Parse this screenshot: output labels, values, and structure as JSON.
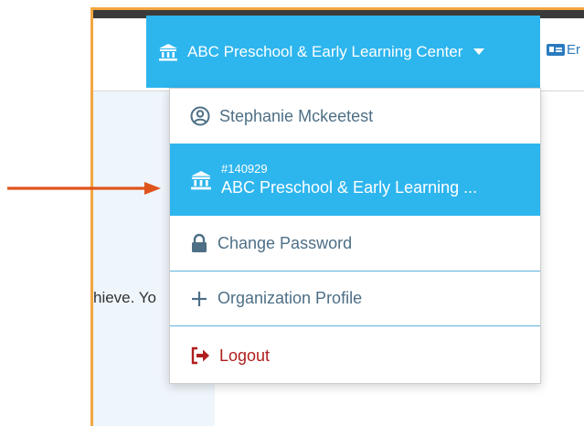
{
  "header": {
    "org_button_label": "ABC Preschool & Early Learning Center",
    "next_button_label": "Er"
  },
  "background": {
    "partial_text": "hieve. Yo"
  },
  "menu": {
    "user_name": "Stephanie Mckeetest",
    "org_id": "#140929",
    "org_name": "ABC Preschool & Early Learning ...",
    "change_password": "Change Password",
    "organization_profile": "Organization Profile",
    "logout": "Logout"
  },
  "icons": {
    "org_button": "bank-icon",
    "user": "user-circle-icon",
    "org": "bank-icon",
    "password": "lock-icon",
    "profile": "plus-icon",
    "logout": "sign-out-icon",
    "next": "id-card-icon"
  },
  "colors": {
    "accent": "#2db5ee",
    "frame_highlight": "#f3a640",
    "arrow": "#e0541c",
    "logout": "#b01e1e"
  }
}
